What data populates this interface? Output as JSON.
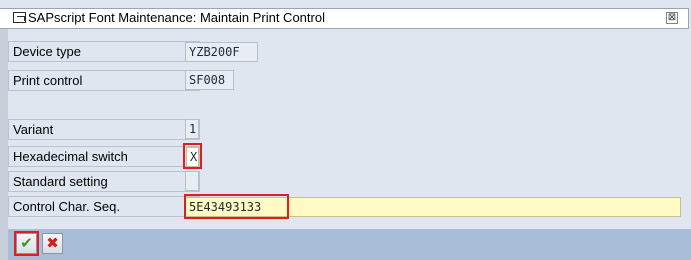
{
  "window": {
    "title": "SAPscript Font Maintenance: Maintain Print Control",
    "close_glyph": "⊠"
  },
  "form": {
    "device_type": {
      "label": "Device type",
      "value": "YZB200F"
    },
    "print_control": {
      "label": "Print control",
      "value": "SF008"
    },
    "variant": {
      "label": "Variant",
      "value": "1"
    },
    "hex_switch": {
      "label": "Hexadecimal switch",
      "value": "X"
    },
    "standard_setting": {
      "label": "Standard setting",
      "value": ""
    },
    "control_char_seq": {
      "label": "Control Char. Seq.",
      "value": "5E43493133"
    }
  },
  "toolbar": {
    "confirm_glyph": "✔",
    "cancel_glyph": "✖"
  },
  "colors": {
    "highlight": "#e31b23",
    "confirm": "#3a9a1a",
    "cancel": "#d0201c",
    "input_bg": "#fff9c4"
  }
}
